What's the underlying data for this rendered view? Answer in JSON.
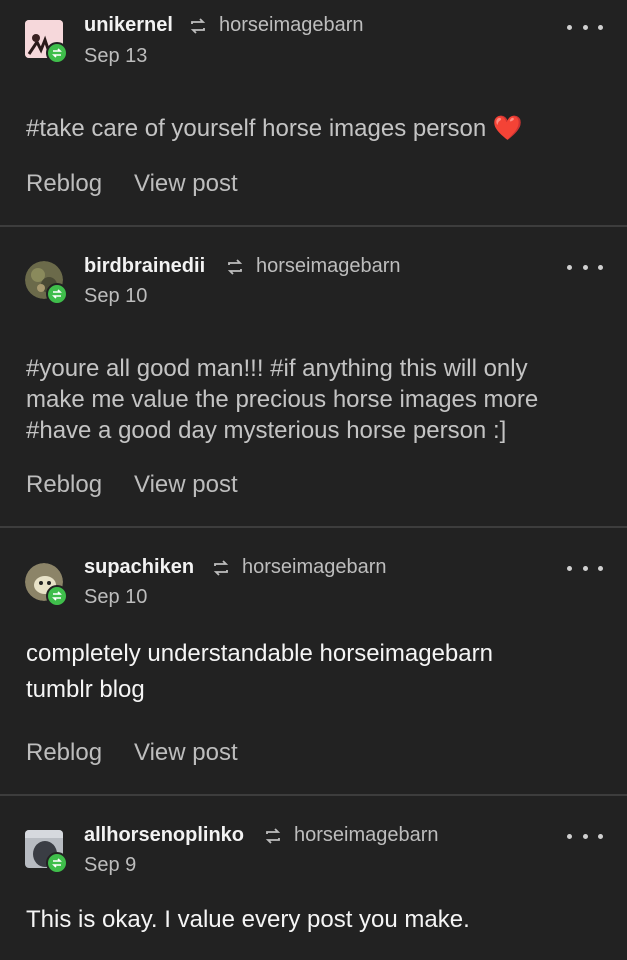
{
  "notes": [
    {
      "username": "unikernel",
      "source": "horseimagebarn",
      "date": "Sep 13",
      "tags": "#take care of yourself horse images person",
      "emoji": "❤️",
      "reblog_label": "Reblog",
      "view_label": "View post"
    },
    {
      "username": "birdbrainedii",
      "source": "horseimagebarn",
      "date": "Sep 10",
      "tags_line1": "#youre all good man!!!  #if anything this will only",
      "tags_line2": "make me value the precious horse images more",
      "tags_line3": "#have a good day mysterious horse person :]",
      "reblog_label": "Reblog",
      "view_label": "View post"
    },
    {
      "username": "supachiken",
      "source": "horseimagebarn",
      "date": "Sep 10",
      "body_line1": "completely understandable horseimagebarn",
      "body_line2": "tumblr blog",
      "reblog_label": "Reblog",
      "view_label": "View post"
    },
    {
      "username": "allhorsenoplinko",
      "source": "horseimagebarn",
      "date": "Sep 9",
      "body_line1": "This is okay. I value every post you make."
    }
  ],
  "colors": {
    "background": "#222222",
    "reblog_badge": "#3fbe4b",
    "divider": "#3d3d3d"
  }
}
